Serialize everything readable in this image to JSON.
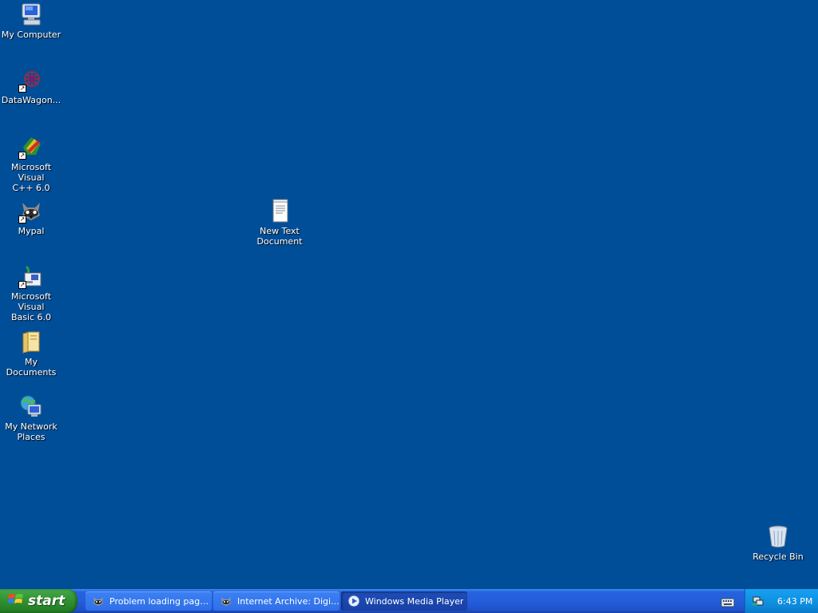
{
  "desktop": {
    "icons": [
      {
        "label": "My Computer",
        "icon": "my-computer-icon"
      },
      {
        "label": "DataWagon...",
        "icon": "datawagon-icon"
      },
      {
        "label": "Microsoft Visual\nC++ 6.0",
        "icon": "visual-cpp-icon"
      },
      {
        "label": "Mypal",
        "icon": "mypal-icon"
      },
      {
        "label": "Microsoft Visual\nBasic 6.0",
        "icon": "visual-basic-icon"
      },
      {
        "label": "My Documents",
        "icon": "my-documents-icon"
      },
      {
        "label": "My Network\nPlaces",
        "icon": "network-places-icon"
      },
      {
        "label": "New Text\nDocument",
        "icon": "text-document-icon"
      },
      {
        "label": "Recycle Bin",
        "icon": "recycle-bin-icon"
      }
    ]
  },
  "taskbar": {
    "start_label": "start",
    "tasks": [
      {
        "label": "Problem loading page...",
        "icon": "mypal-icon",
        "active": false
      },
      {
        "label": "Internet Archive: Digi...",
        "icon": "mypal-icon",
        "active": false
      },
      {
        "label": "Windows Media Player",
        "icon": "media-player-icon",
        "active": true
      }
    ],
    "tray": {
      "clock": "6:43 PM",
      "icon": "network-tray-icon"
    }
  },
  "colors": {
    "desktop_bg": "#004e98",
    "taskbar": "#245edb",
    "start": "#3c9e3e",
    "tray": "#0f8fe0"
  }
}
